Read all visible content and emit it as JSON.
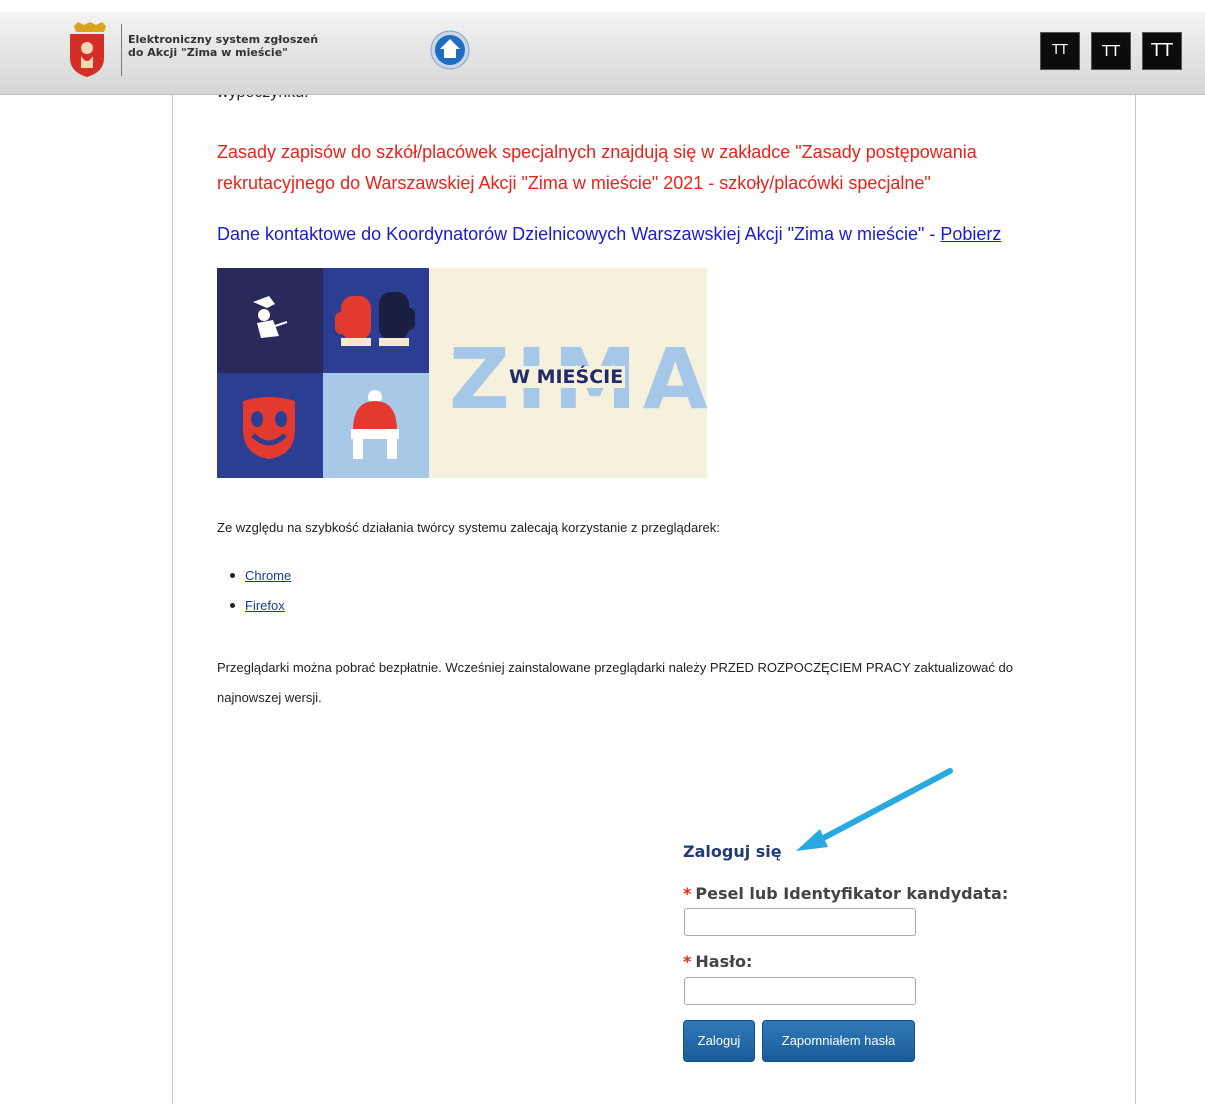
{
  "header": {
    "system_title_line1": "Elektroniczny system zgłoszeń",
    "system_title_line2": "do Akcji \"Zima w mieście\"",
    "font_buttons": [
      "TT",
      "TT",
      "TT"
    ]
  },
  "content": {
    "cut_text": "wypoczynku.",
    "red_notice": "Zasady zapisów do szkół/placówek specjalnych znajdują się w zakładce \"Zasady postępowania rekrutacyjnego do Warszawskiej Akcji \"Zima w mieście\" 2021 - szkoły/placówki specjalne\"",
    "contact_text": "Dane kontaktowe do Koordynatorów Dzielnicowych Warszawskiej Akcji \"Zima w mieście\" - ",
    "contact_link": "Pobierz",
    "banner": {
      "word": "ZIMA",
      "subtitle": "W MIEŚCIE"
    },
    "browser_intro": "Ze względu na szybkość działania twórcy systemu zalecają korzystanie z przeglądarek:",
    "browsers": [
      "Chrome",
      "Firefox"
    ],
    "browser_note": "Przeglądarki można pobrać bezpłatnie. Wcześniej zainstalowane przeglądarki należy PRZED ROZPOCZĘCIEM PRACY zaktualizować do najnowszej wersji."
  },
  "login": {
    "title": "Zaloguj się",
    "required_mark": "*",
    "pesel_label": "Pesel lub Identyfikator kandydata:",
    "pesel_value": "",
    "password_label": "Hasło:",
    "password_value": "",
    "login_button": "Zaloguj",
    "forgot_button": "Zapomniałem hasła"
  },
  "colors": {
    "notice_red": "#e8231c",
    "notice_blue": "#1a1adb",
    "button_blue": "#1a5c99",
    "login_title": "#1f3c76",
    "arrow": "#29a9e1"
  },
  "icons": [
    "warsaw-crest-icon",
    "home-icon",
    "font-size-icon",
    "arrow-icon"
  ]
}
